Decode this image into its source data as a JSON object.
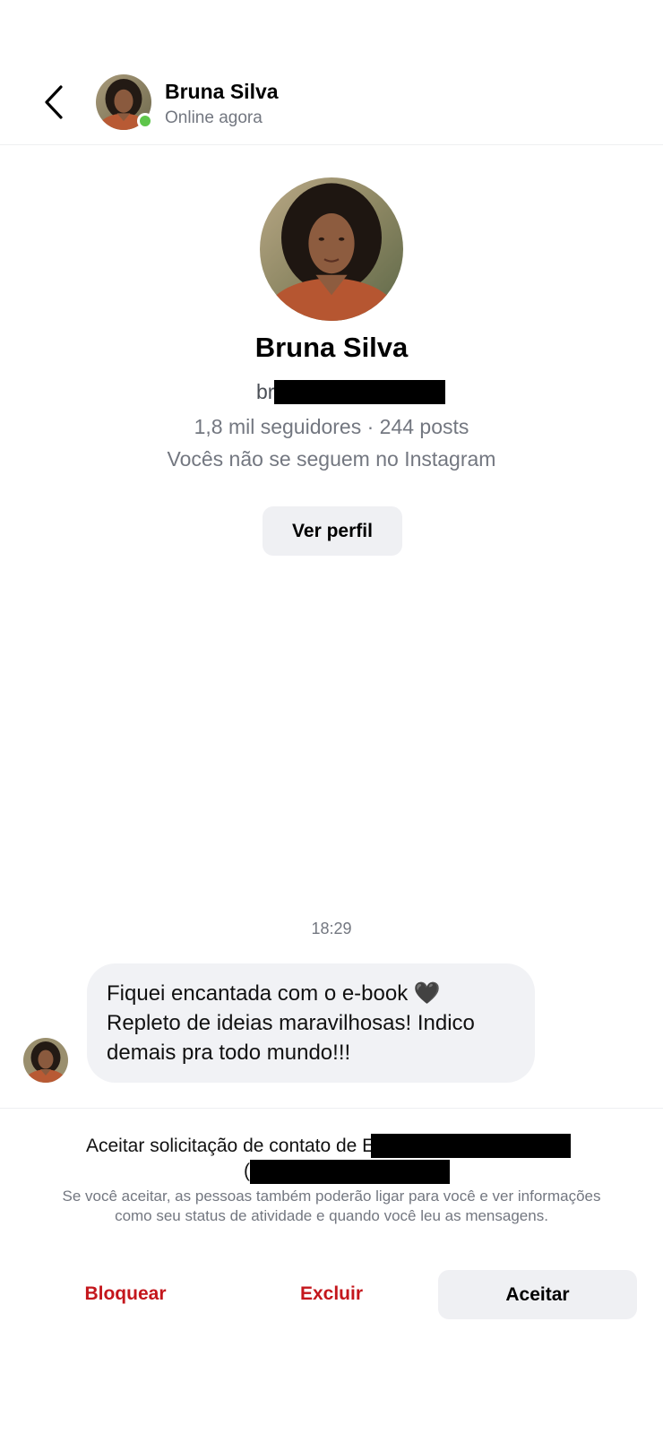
{
  "header": {
    "name": "Bruna Silva",
    "status": "Online agora",
    "back_icon": "chevron-left-icon"
  },
  "profile": {
    "name": "Bruna Silva",
    "handle_visible": "br",
    "stats": "1,8 mil seguidores · 244 posts",
    "mutual": "Vocês não se seguem no Instagram",
    "view_profile_label": "Ver perfil"
  },
  "conversation": {
    "timestamp": "18:29",
    "message": "Fiquei encantada com o e-book 🖤\nRepleto de ideias maravilhosas! Indico\ndemais pra todo mundo!!!"
  },
  "request": {
    "title_prefix": "Aceitar solicitação de contato de E",
    "title_line2_prefix": "(",
    "description": "Se você aceitar, as pessoas também poderão ligar para você e ver informações como seu status de atividade e quando você leu as mensagens.",
    "block_label": "Bloquear",
    "delete_label": "Excluir",
    "accept_label": "Aceitar"
  },
  "colors": {
    "online": "#5ec54b",
    "danger": "#c4161c",
    "muted_text": "#737780",
    "bubble_bg": "#f1f2f5",
    "button_bg": "#eff0f3"
  }
}
